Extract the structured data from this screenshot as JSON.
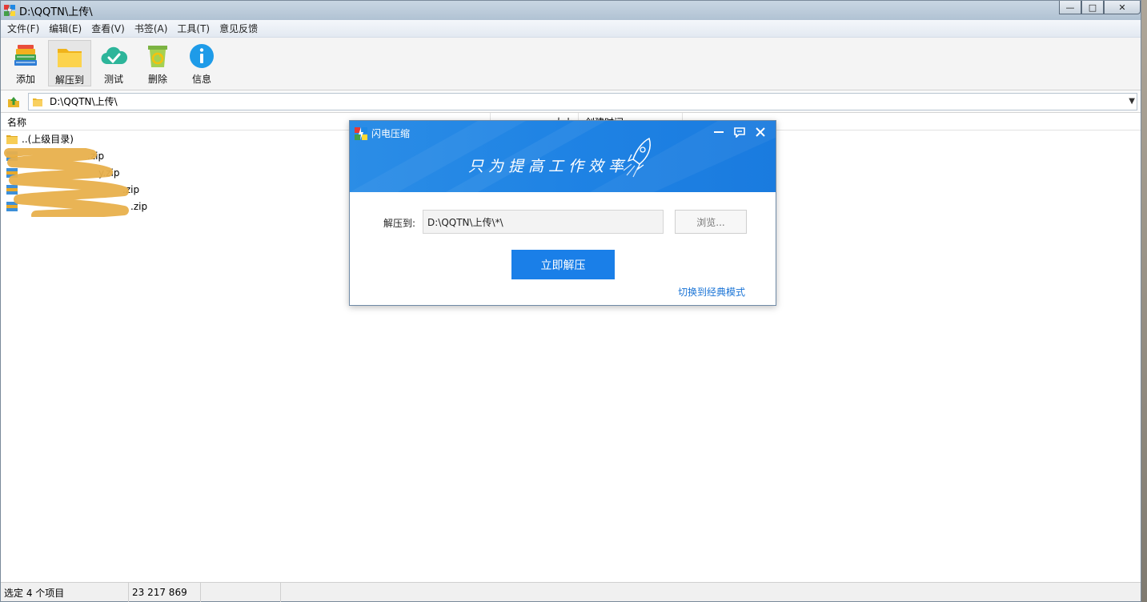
{
  "window": {
    "title": "D:\\QQTN\\上传\\",
    "controls": [
      "—",
      "□",
      "✕"
    ]
  },
  "menu": [
    "文件(F)",
    "编辑(E)",
    "查看(V)",
    "书签(A)",
    "工具(T)",
    "意见反馈"
  ],
  "toolbar": [
    {
      "label": "添加",
      "icon": "books-icon"
    },
    {
      "label": "解压到",
      "icon": "folder-icon"
    },
    {
      "label": "测试",
      "icon": "cloud-check-icon"
    },
    {
      "label": "删除",
      "icon": "recycle-bin-icon"
    },
    {
      "label": "信息",
      "icon": "info-icon"
    }
  ],
  "address": {
    "path": "D:\\QQTN\\上传\\"
  },
  "columns": {
    "name": "名称",
    "size": "大小",
    "created": "创建时间"
  },
  "files": [
    {
      "name": "..(上级目录)",
      "type": "folder"
    },
    {
      "name": ".zip",
      "type": "archive"
    },
    {
      "name": "y.zip",
      "type": "archive"
    },
    {
      "name": ".zip",
      "type": "archive"
    },
    {
      "name": ".zip",
      "type": "archive"
    }
  ],
  "status": {
    "selection": "选定 4 个项目",
    "size": "23 217 869"
  },
  "dialog": {
    "title": "闪电压缩",
    "slogan": "只为提高工作效率",
    "extract_label": "解压到:",
    "path_value": "D:\\QQTN\\上传\\*\\",
    "browse_label": "浏览...",
    "extract_button": "立即解压",
    "classic_link": "切换到经典模式"
  },
  "colors": {
    "accent": "#1a7fe8",
    "banner": "#2187e5",
    "redaction": "#e8b04c"
  }
}
